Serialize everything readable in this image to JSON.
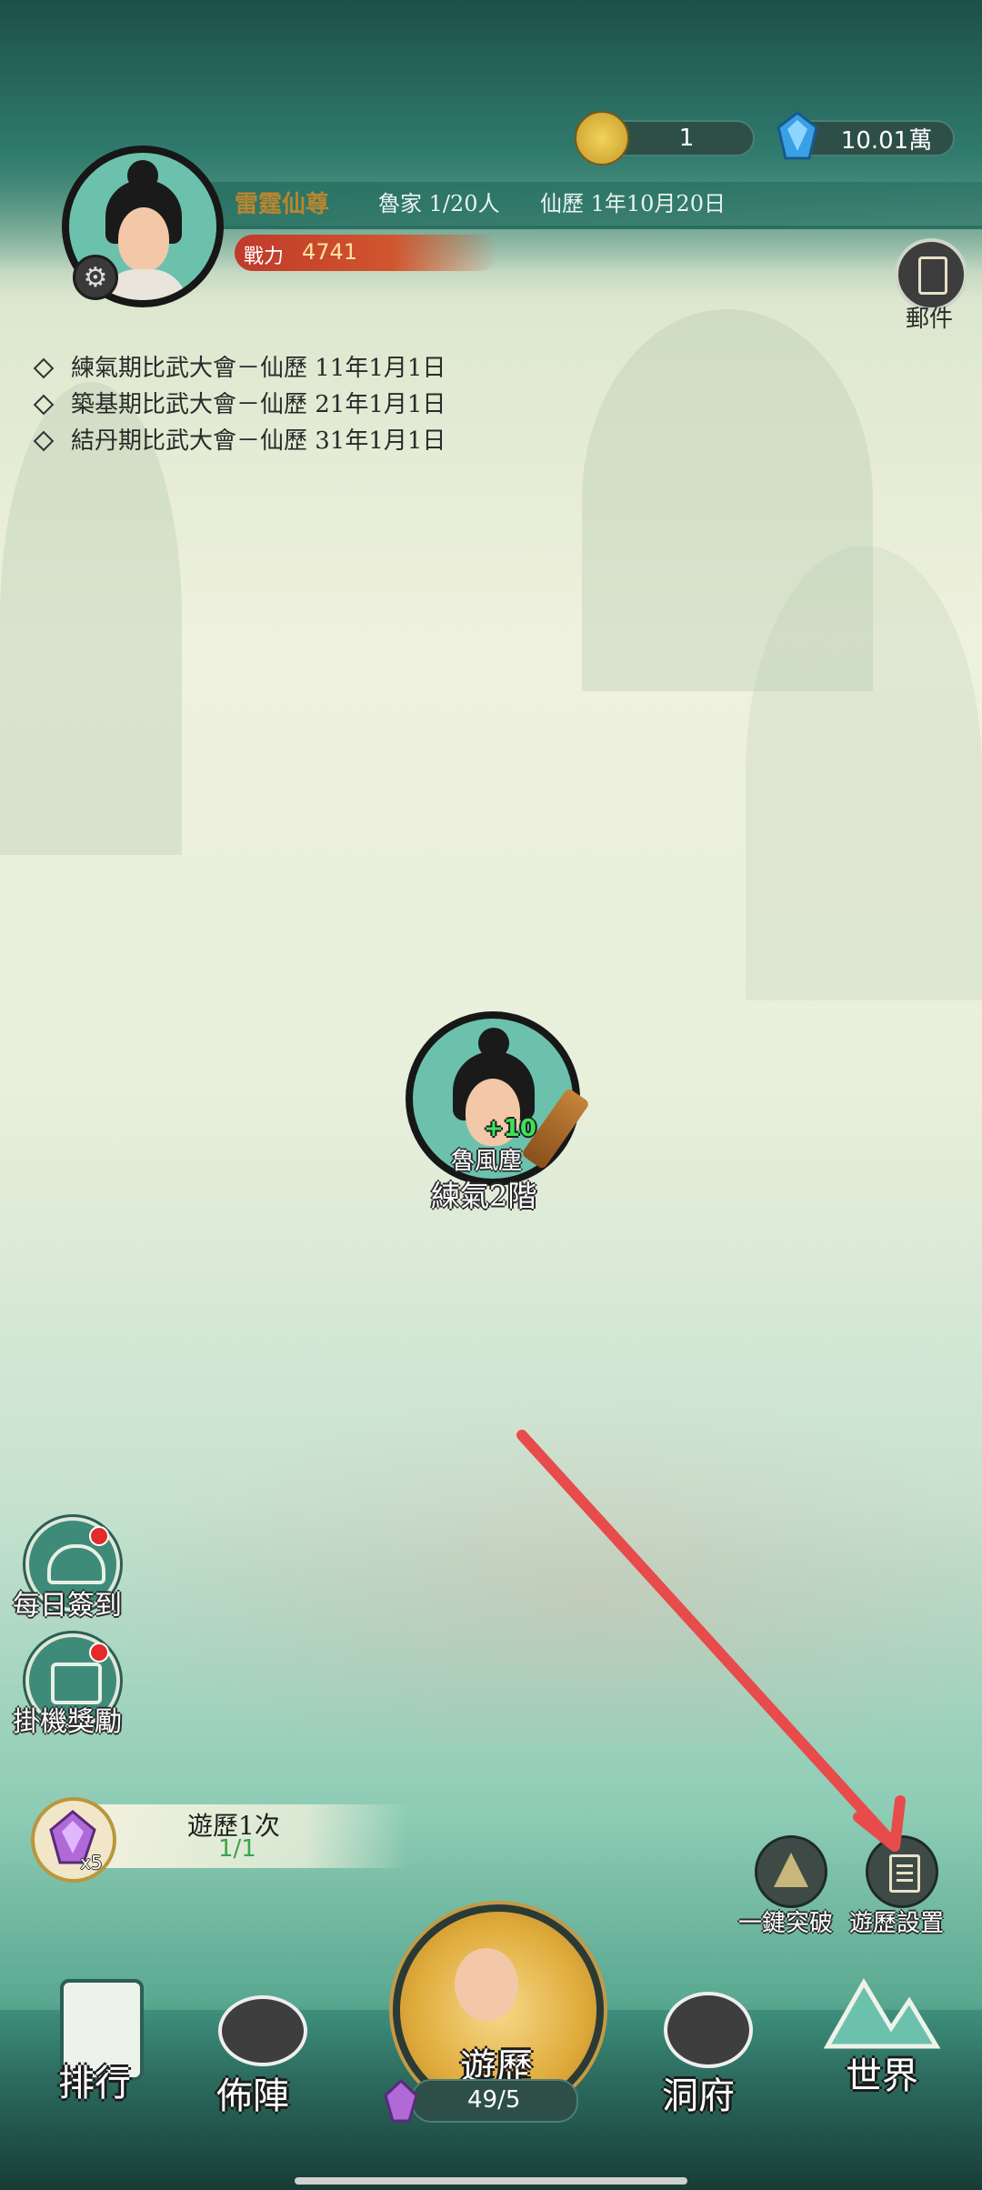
{
  "player": {
    "name": "雷霆仙尊",
    "family": "魯家 1/20人",
    "date": "仙歷 1年10月20日",
    "power_label": "戰力",
    "power_value": "4741"
  },
  "resources": {
    "jade_value": "1",
    "gem_value": "10.01萬"
  },
  "mail": {
    "label": "郵件"
  },
  "notices": [
    "練氣期比武大會－仙歷 11年1月1日",
    "築基期比武大會－仙歷 21年1月1日",
    "結丹期比武大會－仙歷 31年1月1日"
  ],
  "character": {
    "name": "魯風塵",
    "level": "練氣2階",
    "bonus": "+10"
  },
  "side_buttons": {
    "daily_signin": "每日簽到",
    "idle_reward": "掛機獎勵"
  },
  "explore_quest": {
    "title": "遊歷1次",
    "progress": "1/1",
    "gem_count": "x5"
  },
  "actions": {
    "one_click_breakthrough": "一鍵突破",
    "explore_settings": "遊歷設置"
  },
  "nav": {
    "ranking": "排行",
    "formation": "佈陣",
    "explore": "遊歷",
    "explore_count": "49/5",
    "cave": "洞府",
    "world": "世界"
  },
  "colors": {
    "accent_green": "#3f8b79",
    "annotation_arrow": "#e84b4b",
    "power_red": "#c0392b",
    "name_gold": "#b8862e"
  }
}
